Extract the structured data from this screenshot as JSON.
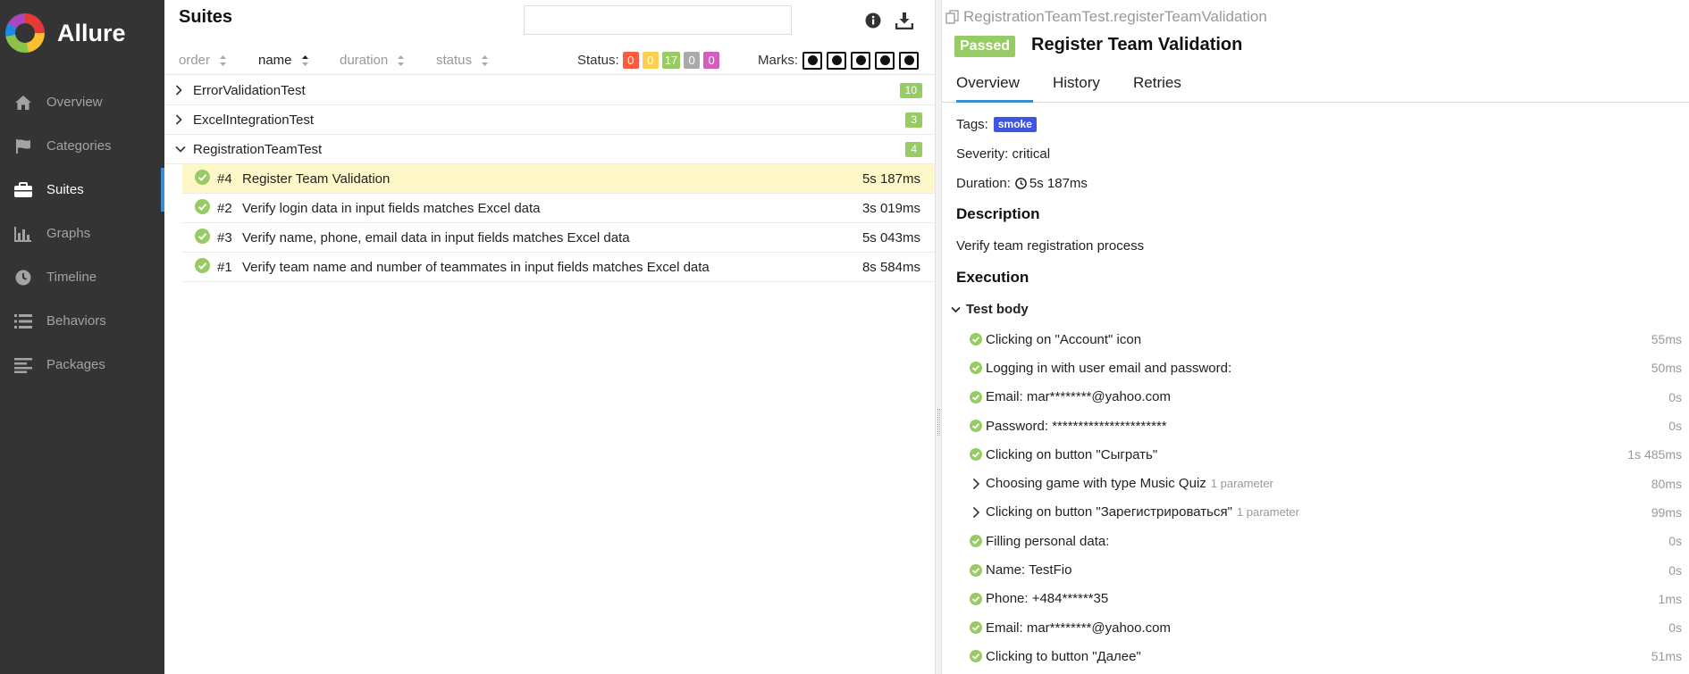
{
  "sidebar": {
    "brand": "Allure",
    "items": [
      {
        "label": "Overview",
        "icon": "home-icon"
      },
      {
        "label": "Categories",
        "icon": "flag-icon"
      },
      {
        "label": "Suites",
        "icon": "briefcase-icon"
      },
      {
        "label": "Graphs",
        "icon": "bar-chart-icon"
      },
      {
        "label": "Timeline",
        "icon": "clock-icon"
      },
      {
        "label": "Behaviors",
        "icon": "list-icon"
      },
      {
        "label": "Packages",
        "icon": "align-left-icon"
      }
    ],
    "active": "Suites"
  },
  "suites": {
    "title": "Suites",
    "search_placeholder": "",
    "sort": {
      "order": "order",
      "name": "name",
      "duration": "duration",
      "status": "status"
    },
    "status_label": "Status:",
    "status_counts": [
      {
        "value": "0",
        "color": "#fd5a3e"
      },
      {
        "value": "0",
        "color": "#ffd050"
      },
      {
        "value": "17",
        "color": "#97cc64"
      },
      {
        "value": "0",
        "color": "#aaaaaa"
      },
      {
        "value": "0",
        "color": "#d35ebe"
      }
    ],
    "marks_label": "Marks:",
    "groups": [
      {
        "name": "ErrorValidationTest",
        "count": "10",
        "expanded": false
      },
      {
        "name": "ExcelIntegrationTest",
        "count": "3",
        "expanded": false
      },
      {
        "name": "RegistrationTeamTest",
        "count": "4",
        "expanded": true
      }
    ],
    "tests": [
      {
        "num": "#4",
        "name": "Register Team Validation",
        "duration": "5s 187ms",
        "selected": true
      },
      {
        "num": "#2",
        "name": "Verify login data in input fields matches Excel data",
        "duration": "3s 019ms"
      },
      {
        "num": "#3",
        "name": "Verify name, phone, email data in input fields matches Excel data",
        "duration": "5s 043ms"
      },
      {
        "num": "#1",
        "name": "Verify team name and number of teammates in input fields matches Excel data",
        "duration": "8s 584ms"
      }
    ]
  },
  "detail": {
    "full_name": "RegistrationTeamTest.registerTeamValidation",
    "status": "Passed",
    "title": "Register Team Validation",
    "tabs": [
      "Overview",
      "History",
      "Retries"
    ],
    "tags_label": "Tags:",
    "tag": "smoke",
    "severity": "Severity: critical",
    "duration_label": "Duration:",
    "duration": "5s 187ms",
    "description_title": "Description",
    "description": "Verify team registration process",
    "execution_title": "Execution",
    "test_body": "Test body",
    "steps": [
      {
        "text": "Clicking on \"Account\" icon",
        "duration": "55ms",
        "type": "passed",
        "param": ""
      },
      {
        "text": "Logging in with user email and password:",
        "duration": "50ms",
        "type": "passed",
        "param": ""
      },
      {
        "text": "Email: mar********@yahoo.com",
        "duration": "0s",
        "type": "passed",
        "param": ""
      },
      {
        "text": "Password: **********************",
        "duration": "0s",
        "type": "passed",
        "param": ""
      },
      {
        "text": "Clicking on button \"Сыграть\"",
        "duration": "1s 485ms",
        "type": "passed",
        "param": ""
      },
      {
        "text": "Choosing game with type Music Quiz",
        "duration": "80ms",
        "type": "expand",
        "param": "1 parameter"
      },
      {
        "text": "Clicking on button \"Зарегистрироваться\"",
        "duration": "99ms",
        "type": "expand",
        "param": "1 parameter"
      },
      {
        "text": "Filling personal data:",
        "duration": "0s",
        "type": "passed",
        "param": ""
      },
      {
        "text": "Name: TestFio",
        "duration": "0s",
        "type": "passed",
        "param": ""
      },
      {
        "text": "Phone: +484******35",
        "duration": "1ms",
        "type": "passed",
        "param": ""
      },
      {
        "text": "Email: mar********@yahoo.com",
        "duration": "0s",
        "type": "passed",
        "param": ""
      },
      {
        "text": "Clicking to button \"Далее\"",
        "duration": "51ms",
        "type": "passed",
        "param": ""
      }
    ]
  }
}
